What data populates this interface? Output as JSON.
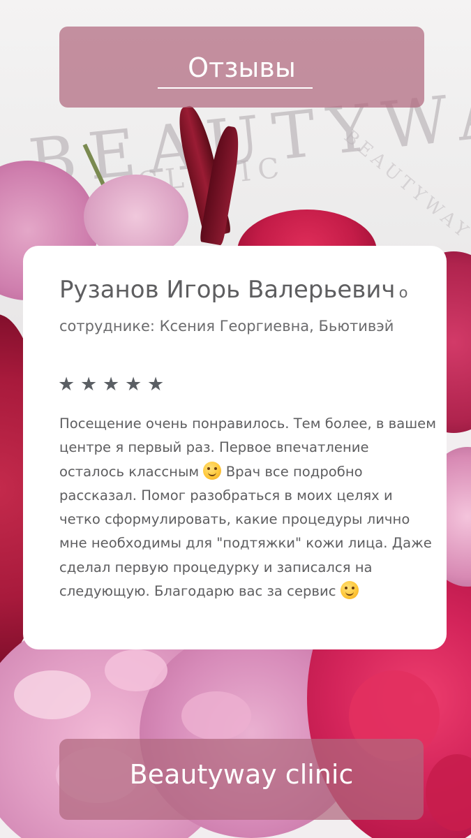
{
  "header": {
    "title": "Отзывы"
  },
  "review": {
    "reviewer_name": "Рузанов Игорь Валерьевич",
    "reviewer_meta": "о сотруднике: Ксения Георгиевна, Бьютивэй",
    "rating": 5,
    "rating_max": 5,
    "text_part1": "Посещение очень понравилось. Тем более, в вашем центре я первый раз. Первое впечатление осталось классным",
    "text_part2": "Врач все подробно рассказал. Помог разобраться в моих целях и четко сформулировать, какие процедуры лично мне необходимы для \"подтяжки\" кожи лица. Даже сделал первую процедурку и записался на следующую. Благодарю вас за сервис",
    "emoji": "smiling-face-icon"
  },
  "footer": {
    "title": "Beautyway clinic"
  },
  "background": {
    "wall_text_1": "BEAUTYWAY",
    "wall_text_2": "CLINIC",
    "wall_text_3": "BEAUTYWAY"
  },
  "colors": {
    "banner": "#b0687e",
    "card": "#ffffff",
    "text": "#5e5e60",
    "stars": "#5b5f64"
  }
}
